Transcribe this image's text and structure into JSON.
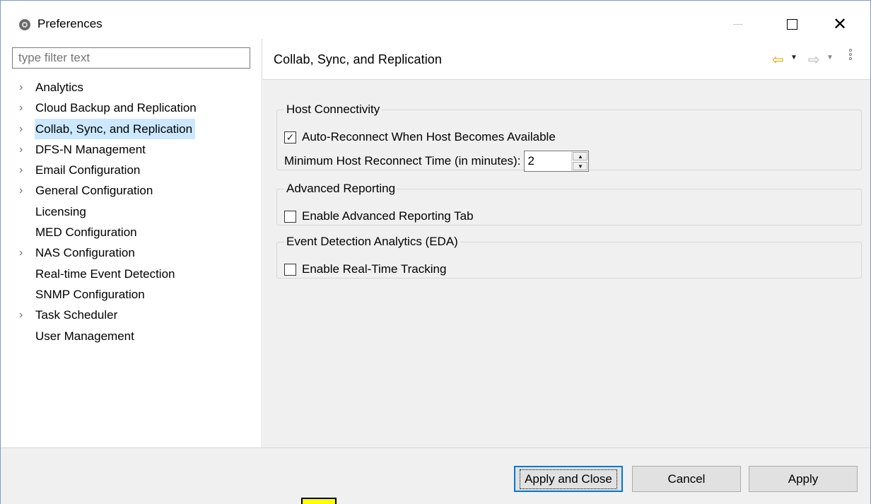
{
  "window": {
    "title": "Preferences",
    "icon": "app-logo-icon",
    "controls": [
      "minimize-icon",
      "maximize-icon",
      "close-icon"
    ]
  },
  "sidebar": {
    "filter_placeholder": "type filter text",
    "items": [
      {
        "label": "Analytics",
        "expandable": true
      },
      {
        "label": "Cloud Backup and Replication",
        "expandable": true
      },
      {
        "label": "Collab, Sync, and Replication",
        "expandable": true,
        "selected": true
      },
      {
        "label": "DFS-N Management",
        "expandable": true
      },
      {
        "label": "Email Configuration",
        "expandable": true
      },
      {
        "label": "General Configuration",
        "expandable": true
      },
      {
        "label": "Licensing",
        "expandable": false
      },
      {
        "label": "MED Configuration",
        "expandable": false
      },
      {
        "label": "NAS Configuration",
        "expandable": true
      },
      {
        "label": "Real-time Event Detection",
        "expandable": false
      },
      {
        "label": "SNMP Configuration",
        "expandable": false
      },
      {
        "label": "Task Scheduler",
        "expandable": true
      },
      {
        "label": "User Management",
        "expandable": false
      }
    ]
  },
  "page": {
    "title": "Collab, Sync, and Replication",
    "nav_icons": [
      "back-arrow-icon",
      "forward-arrow-icon",
      "view-menu-icon"
    ],
    "groups": {
      "host": {
        "legend": "Host Connectivity",
        "auto_reconnect_label": "Auto-Reconnect When Host Becomes Available",
        "auto_reconnect_checked": true,
        "min_reconnect_label": "Minimum Host Reconnect Time (in minutes):",
        "min_reconnect_value": "2"
      },
      "reporting": {
        "legend": "Advanced Reporting",
        "enable_label": "Enable Advanced Reporting Tab",
        "checked": false
      },
      "eda": {
        "legend": "Event Detection Analytics (EDA)",
        "enable_label": "Enable Real-Time Tracking",
        "checked": false
      }
    }
  },
  "footer": {
    "apply_close_label": "Apply and Close",
    "cancel_label": "Cancel",
    "apply_label": "Apply"
  },
  "colors": {
    "selection": "#cce8ff",
    "accent": "#0078d7",
    "nav_arrow": "#d6a400",
    "marker": "#ffff00"
  }
}
